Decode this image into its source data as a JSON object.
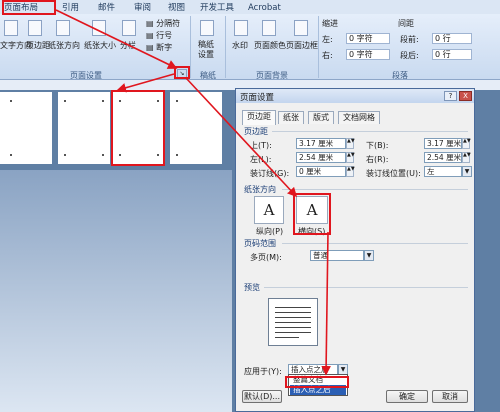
{
  "ribbon_tabs": [
    "页面布局",
    "引用",
    "邮件",
    "审阅",
    "视图",
    "开发工具",
    "Acrobat"
  ],
  "ribbon": {
    "page_setup_buttons": [
      "文字方向",
      "页边距",
      "纸张方向",
      "纸张大小",
      "分栏"
    ],
    "page_setup_small": [
      "分隔符",
      "行号",
      "断字"
    ],
    "draft_button": "稿纸设置",
    "page_bg_buttons": [
      "水印",
      "页面颜色",
      "页面边框"
    ],
    "indent_header": "缩进",
    "indent_left_label": "左:",
    "indent_left_value": "0 字符",
    "indent_right_label": "右:",
    "indent_right_value": "0 字符",
    "spacing_header": "间距",
    "spacing_before_label": "段前:",
    "spacing_before_value": "0 行",
    "spacing_after_label": "段后:",
    "spacing_after_value": "0 行",
    "group_labels": {
      "page_setup": "页面设置",
      "draft": "稿纸",
      "page_bg": "页面背景",
      "paragraph": "段落"
    }
  },
  "dialog": {
    "title": "页面设置",
    "help": "?",
    "close": "X",
    "tabs": [
      "页边距",
      "纸张",
      "版式",
      "文档网格"
    ],
    "margins_section": "页边距",
    "top_label": "上(T):",
    "top_value": "3.17 厘米",
    "bottom_label": "下(B):",
    "bottom_value": "3.17 厘米",
    "left_label": "左(L):",
    "left_value": "2.54 厘米",
    "right_label": "右(R):",
    "right_value": "2.54 厘米",
    "gutter_label": "装订线(G):",
    "gutter_value": "0 厘米",
    "gutter_pos_label": "装订线位置(U):",
    "gutter_pos_value": "左",
    "orientation_section": "纸张方向",
    "portrait": "纵向(P)",
    "landscape": "横向(S)",
    "pages_section": "页码范围",
    "multi_label": "多页(M):",
    "multi_value": "普通",
    "preview_section": "预览",
    "apply_label": "应用于(Y):",
    "apply_value": "插入点之后",
    "apply_options": [
      "整篇文档",
      "插入点之后"
    ],
    "default_button": "默认(D)...",
    "ok_button": "确定",
    "cancel_button": "取消"
  },
  "colors": {
    "highlight": "#e0161e",
    "selection": "#2b5fb4"
  }
}
